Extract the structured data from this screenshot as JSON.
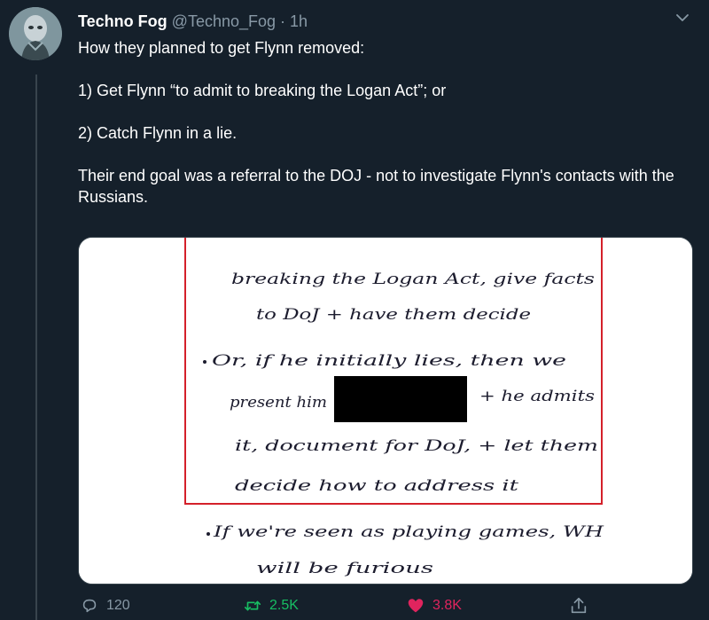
{
  "tweet": {
    "author_name": "Techno Fog",
    "author_handle": "@Techno_Fog",
    "separator": "·",
    "time": "1h",
    "paragraphs": [
      "How they planned to get Flynn removed:",
      "1) Get Flynn “to admit to breaking the Logan Act”; or",
      "2) Catch Flynn in a lie.",
      "Their end goal was a referral to the DOJ - not to investigate Flynn's contacts with the Russians."
    ]
  },
  "media": {
    "handwritten_lines": [
      "breaking the Logan Act, give facts",
      "to DoJ + have them decide",
      "Or, if he initially lies, then we",
      "present him",
      "+ he admits",
      "it, document for DoJ, + let them",
      "decide how to address it",
      "If we're seen as playing games, WH",
      "will be furious"
    ],
    "box_color": "#d4202a"
  },
  "actions": {
    "reply_count": "120",
    "retweet_count": "2.5K",
    "like_count": "3.8K"
  },
  "icons": {
    "menu": "chevron-down-icon",
    "reply": "reply-icon",
    "retweet": "retweet-icon",
    "like": "heart-icon",
    "share": "share-icon"
  },
  "colors": {
    "background": "#15202b",
    "secondary_text": "#8899a6",
    "retweet": "#17bf63",
    "like": "#e0245e"
  }
}
